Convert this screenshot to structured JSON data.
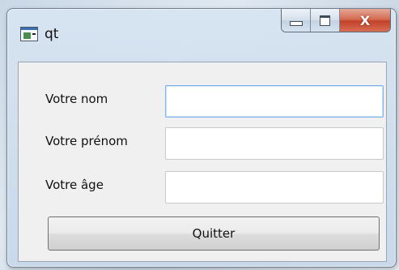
{
  "window": {
    "title": "qt",
    "icon": "qt-app-icon",
    "controls": {
      "minimize": "minimize-icon",
      "maximize": "maximize-icon",
      "close": "close-icon",
      "close_glyph": "X"
    }
  },
  "form": {
    "fields": [
      {
        "label": "Votre nom",
        "value": "",
        "placeholder": "",
        "focused": true
      },
      {
        "label": "Votre prénom",
        "value": "",
        "placeholder": ""
      },
      {
        "label": "Votre âge",
        "value": "",
        "placeholder": ""
      }
    ],
    "quit_label": "Quitter"
  },
  "colors": {
    "close_button": "#c2422a",
    "focus_border": "#7eb4ea",
    "client_background": "#f0f0f0"
  }
}
